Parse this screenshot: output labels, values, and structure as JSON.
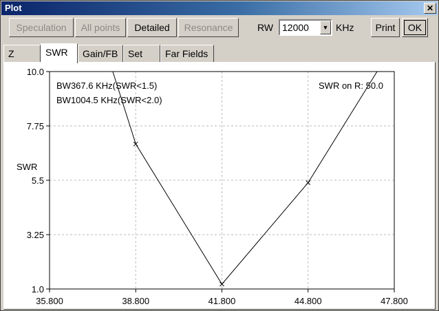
{
  "window": {
    "title": "Plot",
    "close_label": "✕"
  },
  "toolbar": {
    "speculation": "Speculation",
    "all_points": "All points",
    "detailed": "Detailed",
    "resonance": "Resonance",
    "rw_label": "RW",
    "rw_value": "12000",
    "unit_label": "KHz",
    "print": "Print",
    "ok": "OK"
  },
  "tabs": [
    {
      "label": "Z"
    },
    {
      "label": "SWR"
    },
    {
      "label": "Gain/FB"
    },
    {
      "label": "Set"
    },
    {
      "label": "Far Fields"
    }
  ],
  "chart_data": {
    "type": "line",
    "ylabel": "SWR",
    "x_ticks": [
      "35.800",
      "38.800",
      "41.800",
      "44.800",
      "47.800"
    ],
    "y_ticks": [
      "10.0",
      "7.75",
      "5.5",
      "3.25",
      "1.0"
    ],
    "xlim": [
      35.8,
      47.8
    ],
    "ylim": [
      1.0,
      10.0
    ],
    "grid": true,
    "series": [
      {
        "x": [
          38.0,
          38.8,
          41.8,
          44.8,
          47.2
        ],
        "y": [
          10.0,
          7.0,
          1.2,
          5.4,
          10.0
        ],
        "markers": [
          false,
          true,
          true,
          true,
          false
        ]
      }
    ],
    "annotations": {
      "bw15": "BW367.6 KHz(SWR<1.5)",
      "bw20": "BW1004.5 KHz(SWR<2.0)",
      "swr_on": "SWR on R: 50.0"
    }
  }
}
